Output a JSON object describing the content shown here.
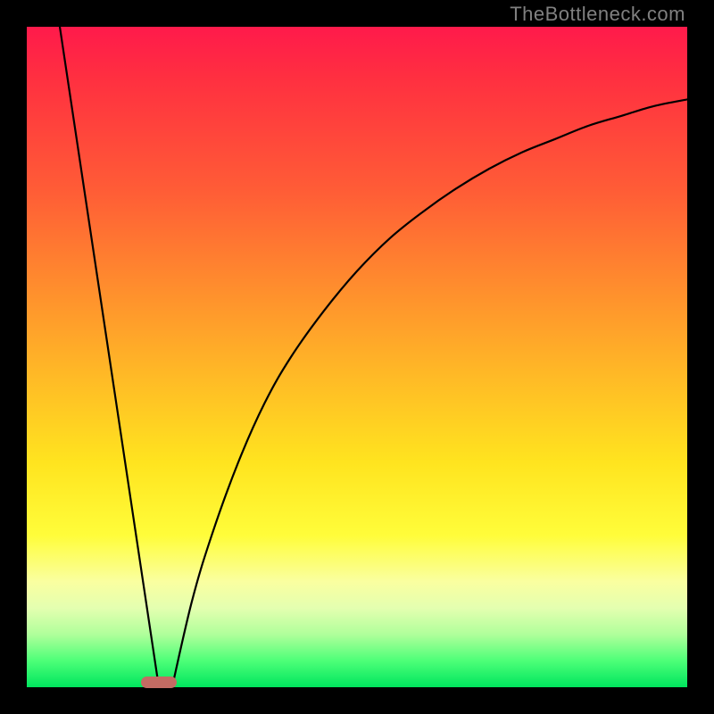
{
  "watermark": "TheBottleneck.com",
  "chart_data": {
    "type": "line",
    "title": "",
    "xlabel": "",
    "ylabel": "",
    "xlim": [
      0,
      100
    ],
    "ylim": [
      0,
      100
    ],
    "series": [
      {
        "name": "left-line",
        "x": [
          5,
          20
        ],
        "values": [
          100,
          0
        ]
      },
      {
        "name": "right-curve",
        "x": [
          22,
          25,
          28,
          32,
          36,
          40,
          45,
          50,
          55,
          60,
          65,
          70,
          75,
          80,
          85,
          90,
          95,
          100
        ],
        "values": [
          0,
          13,
          23,
          34,
          43,
          50,
          57,
          63,
          68,
          72,
          75.5,
          78.5,
          81,
          83,
          85,
          86.5,
          88,
          89
        ]
      }
    ],
    "marker": {
      "x_center": 20,
      "width_pct": 5.4
    },
    "gradient_stops": [
      {
        "pos": 0,
        "color": "#ff1a4b"
      },
      {
        "pos": 25,
        "color": "#ff5d36"
      },
      {
        "pos": 53,
        "color": "#ffba26"
      },
      {
        "pos": 77,
        "color": "#fffd3a"
      },
      {
        "pos": 92,
        "color": "#b0ff9b"
      },
      {
        "pos": 100,
        "color": "#00e55e"
      }
    ]
  }
}
